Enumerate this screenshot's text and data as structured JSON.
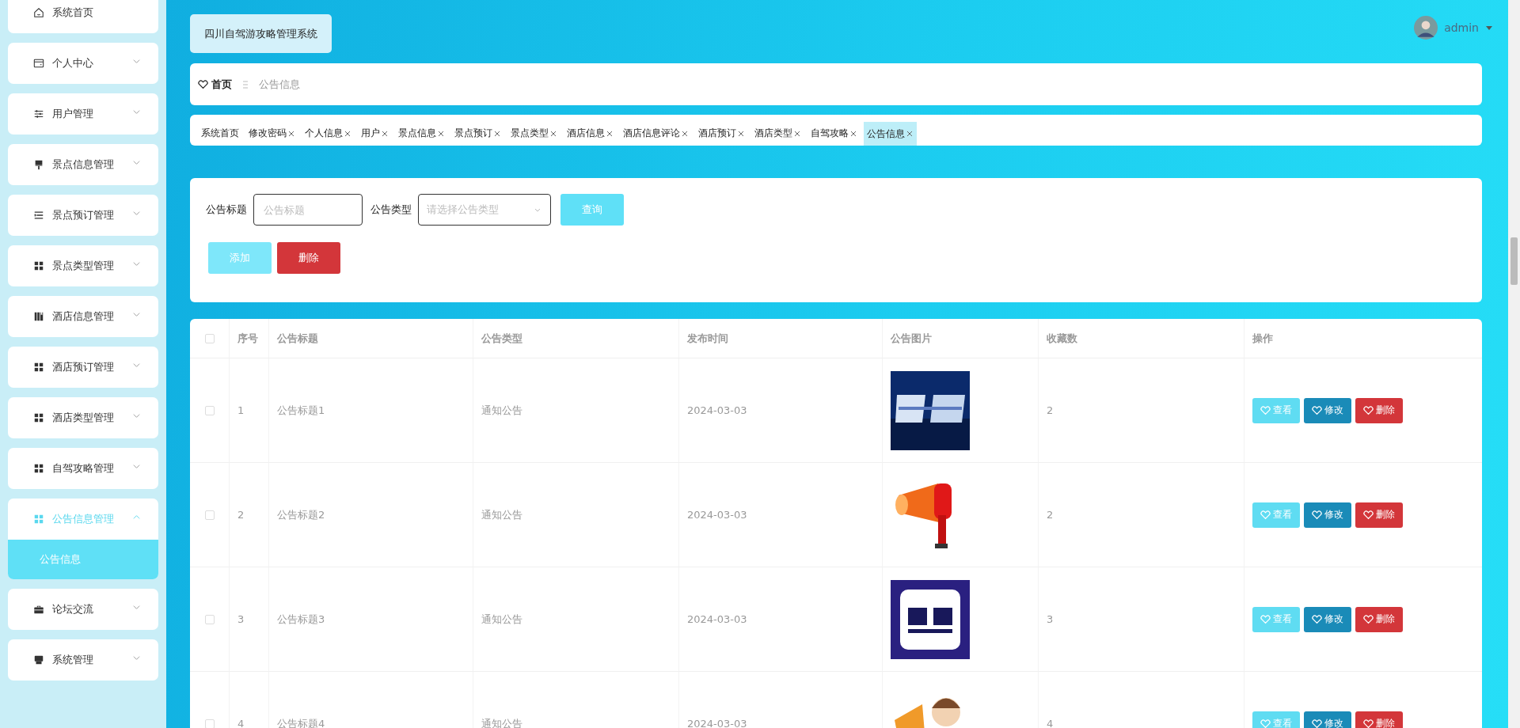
{
  "app_title": "四川自驾游攻略管理系统",
  "user": {
    "name": "admin"
  },
  "sidebar": {
    "items": [
      {
        "label": "系统首页",
        "kind": "link",
        "selected": false
      },
      {
        "label": "个人中心",
        "kind": "menu",
        "expanded": false,
        "selected": false
      },
      {
        "label": "用户管理",
        "kind": "menu",
        "expanded": false,
        "selected": false
      },
      {
        "label": "景点信息管理",
        "kind": "menu",
        "expanded": false,
        "selected": false
      },
      {
        "label": "景点预订管理",
        "kind": "menu",
        "expanded": false,
        "selected": false
      },
      {
        "label": "景点类型管理",
        "kind": "menu",
        "expanded": false,
        "selected": false
      },
      {
        "label": "酒店信息管理",
        "kind": "menu",
        "expanded": false,
        "selected": false
      },
      {
        "label": "酒店预订管理",
        "kind": "menu",
        "expanded": false,
        "selected": false
      },
      {
        "label": "酒店类型管理",
        "kind": "menu",
        "expanded": false,
        "selected": false
      },
      {
        "label": "自驾攻略管理",
        "kind": "menu",
        "expanded": false,
        "selected": false
      },
      {
        "label": "公告信息管理",
        "kind": "menu",
        "expanded": true,
        "selected": true,
        "children": [
          {
            "label": "公告信息",
            "selected": true
          }
        ]
      },
      {
        "label": "论坛交流",
        "kind": "menu",
        "expanded": false,
        "selected": false
      },
      {
        "label": "系统管理",
        "kind": "menu",
        "expanded": false,
        "selected": false
      }
    ]
  },
  "breadcrumb": {
    "home": "首页",
    "current": "公告信息"
  },
  "tabs": [
    {
      "label": "系统首页",
      "closable": false,
      "selected": false
    },
    {
      "label": "修改密码",
      "closable": true,
      "selected": false
    },
    {
      "label": "个人信息",
      "closable": true,
      "selected": false
    },
    {
      "label": "用户",
      "closable": true,
      "selected": false
    },
    {
      "label": "景点信息",
      "closable": true,
      "selected": false
    },
    {
      "label": "景点预订",
      "closable": true,
      "selected": false
    },
    {
      "label": "景点类型",
      "closable": true,
      "selected": false
    },
    {
      "label": "酒店信息",
      "closable": true,
      "selected": false
    },
    {
      "label": "酒店信息评论",
      "closable": true,
      "selected": false
    },
    {
      "label": "酒店预订",
      "closable": true,
      "selected": false
    },
    {
      "label": "酒店类型",
      "closable": true,
      "selected": false
    },
    {
      "label": "自驾攻略",
      "closable": true,
      "selected": false
    },
    {
      "label": "公告信息",
      "closable": true,
      "selected": true
    }
  ],
  "filters": {
    "title_label": "公告标题",
    "title_placeholder": "公告标题",
    "type_label": "公告类型",
    "type_placeholder": "请选择公告类型",
    "query_button": "查询"
  },
  "actions": [
    {
      "label": "添加",
      "kind": "add"
    },
    {
      "label": "删除",
      "kind": "delete"
    }
  ],
  "table": {
    "select_all_checked": false,
    "columns": [
      "序号",
      "公告标题",
      "公告类型",
      "发布时间",
      "公告图片",
      "收藏数",
      "操作"
    ],
    "rows": [
      {
        "checked": false,
        "index": "1",
        "title": "公告标题1",
        "type": "通知公告",
        "date": "2024-03-03",
        "picture": {
          "kind": "picture"
        },
        "favorites": "2",
        "actions": [
          {
            "label": "查看",
            "kind": "view"
          },
          {
            "label": "修改",
            "kind": "edit"
          },
          {
            "label": "删除",
            "kind": "delete"
          }
        ]
      },
      {
        "checked": false,
        "index": "2",
        "title": "公告标题2",
        "type": "通知公告",
        "date": "2024-03-03",
        "picture": {
          "kind": "picture"
        },
        "favorites": "2",
        "actions": [
          {
            "label": "查看",
            "kind": "view"
          },
          {
            "label": "修改",
            "kind": "edit"
          },
          {
            "label": "删除",
            "kind": "delete"
          }
        ]
      },
      {
        "checked": false,
        "index": "3",
        "title": "公告标题3",
        "type": "通知公告",
        "date": "2024-03-03",
        "picture": {
          "kind": "picture"
        },
        "favorites": "3",
        "actions": [
          {
            "label": "查看",
            "kind": "view"
          },
          {
            "label": "修改",
            "kind": "edit"
          },
          {
            "label": "删除",
            "kind": "delete"
          }
        ]
      },
      {
        "checked": false,
        "index": "4",
        "title": "公告标题4",
        "type": "通知公告",
        "date": "2024-03-03",
        "picture": {
          "kind": "picture"
        },
        "favorites": "4",
        "actions": [
          {
            "label": "查看",
            "kind": "view"
          },
          {
            "label": "修改",
            "kind": "edit"
          },
          {
            "label": "删除",
            "kind": "delete"
          }
        ]
      }
    ]
  }
}
